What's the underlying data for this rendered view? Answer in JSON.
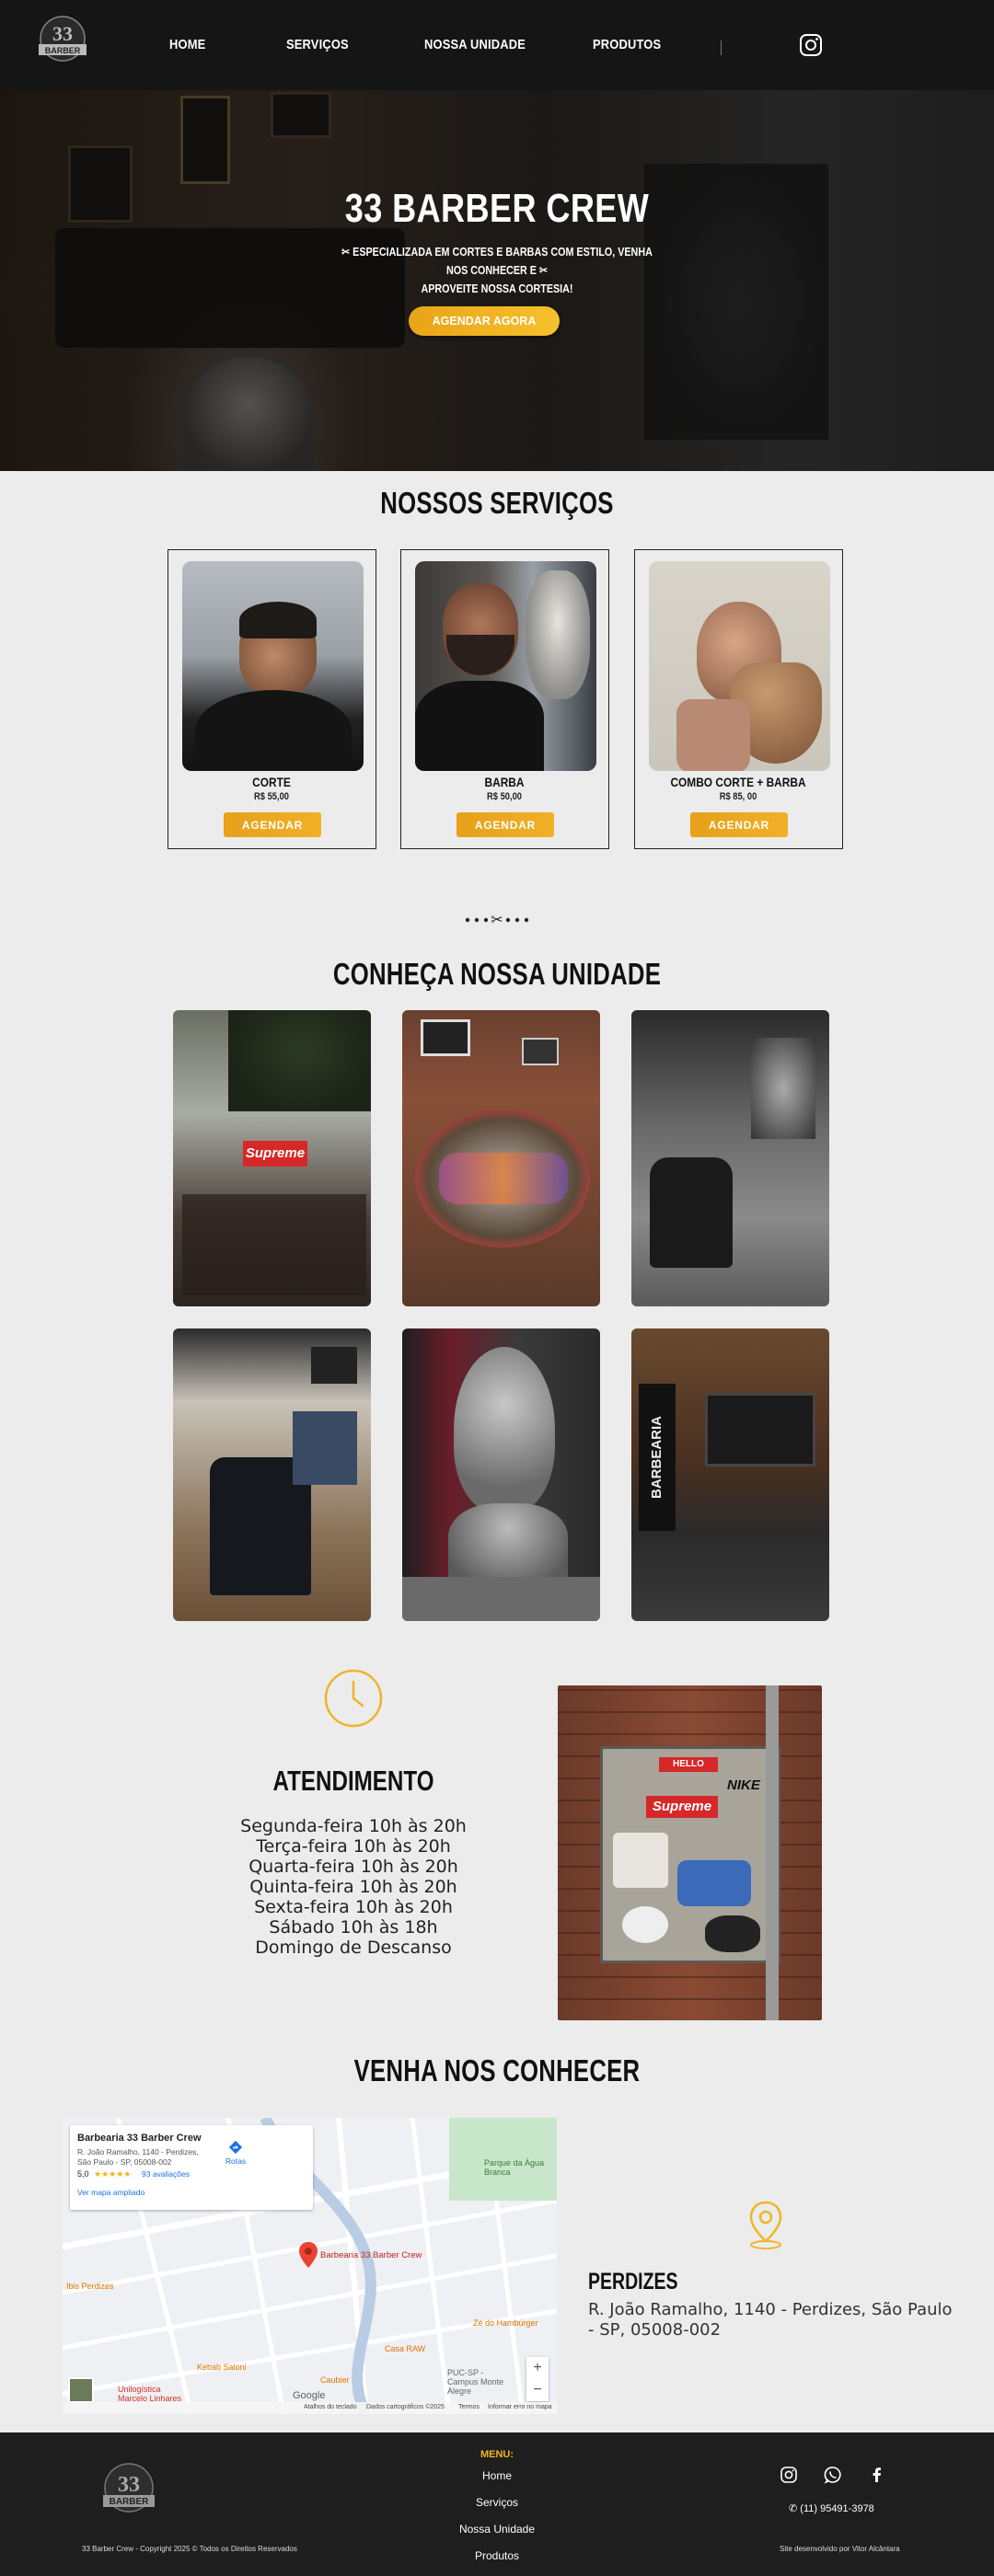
{
  "nav": {
    "logo_text": "33 BARBER CREW",
    "items": [
      "HOME",
      "SERVIÇOS",
      "NOSSA UNIDADE",
      "PRODUTOS"
    ],
    "instagram_icon": "instagram-icon"
  },
  "hero": {
    "title": "33 BARBER CREW",
    "subtitle_line1": "ESPECIALIZADA EM CORTES E BARBAS COM ESTILO, VENHA NOS CONHECER E",
    "subtitle_line2": "APROVEITE NOSSA CORTESIA!",
    "cta": "AGENDAR AGORA"
  },
  "services": {
    "title": "NOSSOS SERVIÇOS",
    "items": [
      {
        "name": "CORTE",
        "price": "R$ 55,00",
        "button": "AGENDAR"
      },
      {
        "name": "BARBA",
        "price": "R$ 50,00",
        "button": "AGENDAR"
      },
      {
        "name": "COMBO CORTE + BARBA",
        "price": "R$ 85, 00",
        "button": "AGENDAR"
      }
    ]
  },
  "unit": {
    "title": "CONHEÇA NOSSA UNIDADE",
    "photo_texts": {
      "supreme": "Supreme",
      "barbearia": "BARBEARIA"
    }
  },
  "schedule": {
    "title": "ATENDIMENTO",
    "hours": [
      "Segunda-feira 10h às 20h",
      "Terça-feira 10h às 20h",
      "Quarta-feira 10h às 20h",
      "Quinta-feira 10h às 20h",
      "Sexta-feira 10h às 20h",
      "Sábado 10h às 18h",
      "Domingo de Descanso"
    ],
    "poster_texts": {
      "hello": "HELLO",
      "supreme": "Supreme",
      "nike": "NIKE"
    }
  },
  "visit": {
    "title": "VENHA NOS CONHECER",
    "map": {
      "place_name": "Barbearia 33 Barber Crew",
      "address_line1": "R. João Ramalho, 1140 - Perdizes,",
      "address_line2": "São Paulo - SP, 05008-002",
      "rating": "5,0",
      "stars": "★★★★★",
      "reviews": "93 avaliações",
      "larger_map": "Ver mapa ampliado",
      "routes": "Rotas",
      "pin_label": "Barbearia 33 Barber Crew",
      "park": "Parque da Água Branca",
      "poi_1": "Zé do Hambúrger",
      "poi_2": "Kebab Saloni",
      "poi_3": "Casa RAW",
      "poi_4": "Caubier",
      "poi_5": "Unilogística Marcelo Linhares",
      "poi_6": "PUC-SP - Campus Monte Alegre",
      "poi_7": "Ibis Perdizes",
      "footer_items": [
        "Atalhos do teclado",
        "Dados cartográficos ©2025",
        "Termos",
        "Informar erro no mapa"
      ],
      "google": "Google"
    },
    "city": "PERDIZES",
    "address": "R. João Ramalho, 1140 - Perdizes, São Paulo - SP, 05008-002"
  },
  "footer": {
    "menu_title": "MENU:",
    "menu_items": [
      "Home",
      "Serviços",
      "Nossa Unidade",
      "Produtos"
    ],
    "phone": "(11) 95491-3978",
    "copyright": "33 Barber Crew - Copyright 2025 © Todos os Direitos Reservados",
    "developer": "Site desenvolvido por Vitor Alcântara"
  },
  "colors": {
    "accent": "#f0b429",
    "header_bg": "#151515",
    "page_bg": "#ececec",
    "footer_bg": "#1e1e1e"
  }
}
